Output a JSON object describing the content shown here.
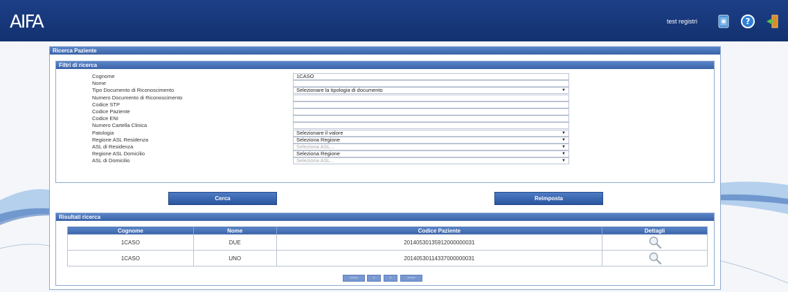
{
  "header": {
    "logo": "AIFA",
    "user_label": "test registri",
    "icons": [
      "book-icon",
      "help-icon",
      "exit-icon"
    ]
  },
  "panel": {
    "title": "Ricerca Paziente",
    "filters": {
      "title": "Filtri di ricerca",
      "rows": [
        {
          "label": "Cognome",
          "value": "1CASO",
          "type": "text"
        },
        {
          "label": "Nome",
          "value": "",
          "type": "text"
        },
        {
          "label": "Tipo Documento di Riconoscimento",
          "value": "Selezionare la tipologia di documento",
          "type": "select"
        },
        {
          "label": "Numero Documento di Riconoscimento",
          "value": "",
          "type": "text"
        },
        {
          "label": "Codice STP",
          "value": "",
          "type": "text"
        },
        {
          "label": "Codice Paziente",
          "value": "",
          "type": "text"
        },
        {
          "label": "Codice ENI",
          "value": "",
          "type": "text"
        },
        {
          "label": "Numero Cartella Clinica",
          "value": "",
          "type": "text"
        },
        {
          "label": "Patologia",
          "value": "Selezionare il valore",
          "type": "select"
        },
        {
          "label": "Regione ASL Residenza",
          "value": "Seleziona Regione",
          "type": "select"
        },
        {
          "label": "ASL di Residenza",
          "value": "Seleziona ASL...",
          "type": "select",
          "disabled": true
        },
        {
          "label": "Regione ASL Domicilio",
          "value": "Seleziona Regione",
          "type": "select"
        },
        {
          "label": "ASL di Domicilio",
          "value": "Seleziona ASL...",
          "type": "select",
          "disabled": true
        }
      ]
    },
    "buttons": {
      "search": "Cerca",
      "reset": "Reimposta"
    },
    "results": {
      "title": "Risultati ricerca",
      "columns": [
        "Cognome",
        "Nome",
        "Codice Paziente",
        "Dettagli"
      ],
      "rows": [
        {
          "cognome": "1CASO",
          "nome": "DUE",
          "codice": "20140530135912000000031"
        },
        {
          "cognome": "1CASO",
          "nome": "UNO",
          "codice": "20140530114337000000031"
        }
      ],
      "pager": [
        "<<<<",
        "<",
        ">",
        ">>>>"
      ]
    }
  },
  "colors": {
    "topbar": "#1c3f87",
    "header_blue": "#3a62a8",
    "button_blue": "#2a559f"
  }
}
